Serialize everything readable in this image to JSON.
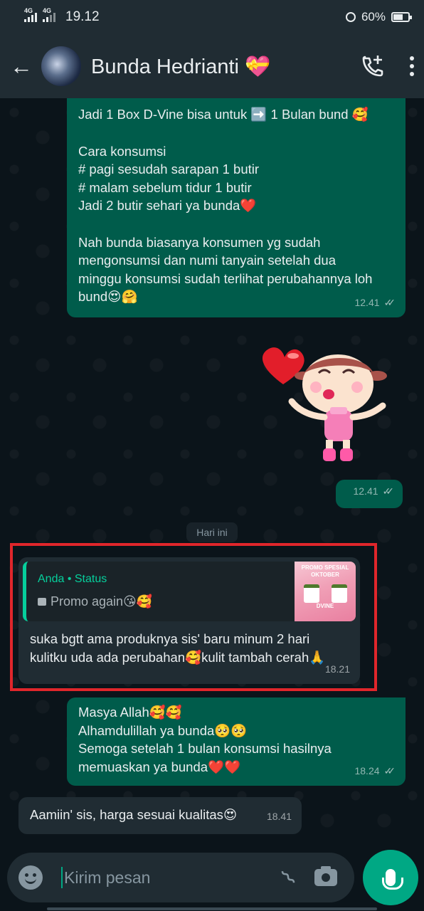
{
  "status_bar": {
    "network_1": "4G",
    "network_2": "4G",
    "time": "19.12",
    "battery": "60%"
  },
  "header": {
    "contact_name": "Bunda Hedrianti",
    "name_emoji": "💝",
    "back_icon": "arrow-left",
    "call_icon": "phone-plus",
    "menu_icon": "more-vertical"
  },
  "messages": [
    {
      "direction": "out",
      "lines": [
        "Jadi 1 Box D-Vine bisa untuk ➡️ 1 Bulan bund 🥰",
        "",
        "Cara konsumsi",
        "# pagi sesudah sarapan 1 butir",
        "# malam sebelum tidur 1 butir",
        "Jadi 2 butir sehari ya bunda❤️",
        "",
        "Nah bunda biasanya konsumen yg sudah",
        "mengonsumsi dan numi tanyain setelah dua",
        "minggu konsumsi sudah terlihat perubahannya loh",
        "bund😍🤗"
      ],
      "time": "12.41"
    },
    {
      "direction": "out",
      "type": "sticker",
      "time": "12.41"
    },
    {
      "direction": "in",
      "quote": {
        "title": "Anda • Status",
        "body": "Promo again😘🥰",
        "thumb_title": "PROMO SPESIAL OKTOBER",
        "thumb_caption": "DVINE"
      },
      "lines": [
        "suka bgtt ama produknya sis' baru minum 2 hari",
        "kulitku uda ada perubahan🥰kulit tambah cerah🙏"
      ],
      "time": "18.21"
    },
    {
      "direction": "out",
      "lines": [
        "Masya Allah🥰🥰",
        "Alhamdulillah ya bunda🥺🥺",
        "Semoga setelah 1 bulan konsumsi hasilnya",
        "memuaskan ya bunda❤️❤️"
      ],
      "time": "18.24"
    },
    {
      "direction": "in",
      "lines": [
        "Aamiin' sis, harga sesuai kualitas😍"
      ],
      "time": "18.41"
    }
  ],
  "date_chip": "Hari ini",
  "composer": {
    "placeholder": "Kirim pesan",
    "emoji_icon": "smiley",
    "attach_icon": "paperclip",
    "camera_icon": "camera",
    "mic_icon": "microphone"
  },
  "colors": {
    "header_bg": "#202c33",
    "chat_bg": "#0b141a",
    "outgoing_bubble": "#005c4b",
    "incoming_bubble": "#202c33",
    "accent": "#00a884",
    "highlight_border": "#e0262b"
  }
}
